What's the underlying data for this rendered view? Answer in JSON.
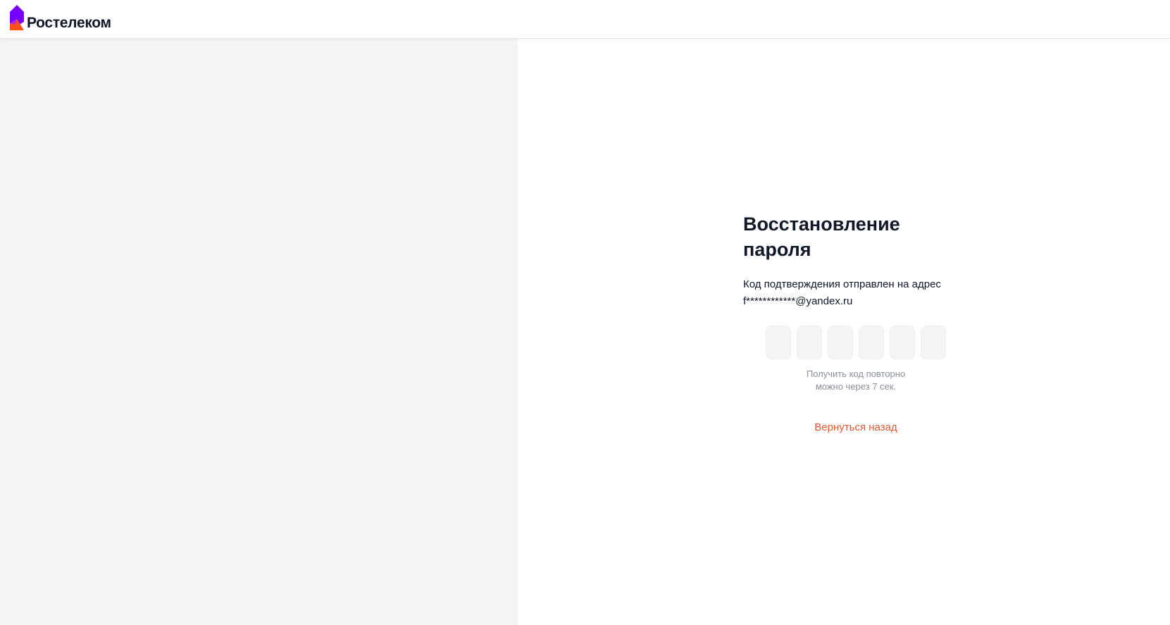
{
  "brand": {
    "name": "Ростелеком",
    "colors": {
      "purple": "#7700ff",
      "orange": "#ff4f12"
    }
  },
  "recovery": {
    "title": "Восстановление пароля",
    "message_line1": "Код подтверждения отправлен на адрес",
    "message_line2": "f************@yandex.ru",
    "code_cells": [
      "",
      "",
      "",
      "",
      "",
      ""
    ],
    "resend_line1": "Получить код повторно",
    "resend_line2": "можно через 7 сек.",
    "back_link": "Вернуться назад"
  },
  "colors": {
    "accent": "#e4572e",
    "panel_bg": "#f3f4f6",
    "muted_text": "#8a8f98"
  }
}
